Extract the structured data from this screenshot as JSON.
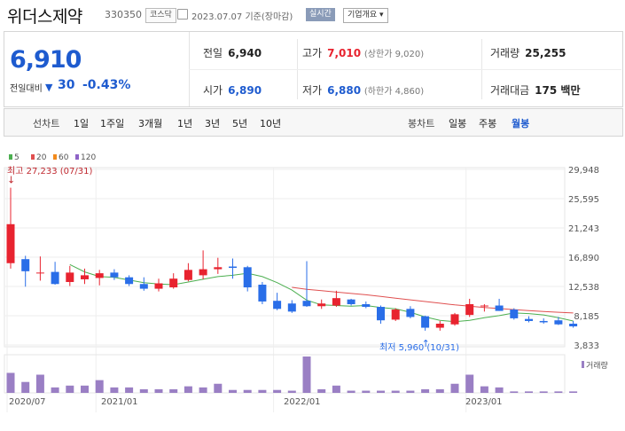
{
  "header": {
    "name": "위더스제약",
    "code": "330350",
    "market": "코스닥",
    "date": "2023.07.07",
    "basis": "기준(장마감)",
    "realtime": "실시간",
    "corp_overview": "기업개요 ▾"
  },
  "quote": {
    "price": "6,910",
    "change_label": "전일대비",
    "change_arrow": "▼",
    "change": "30",
    "change_pct": "-0.43%",
    "prev_close_label": "전일",
    "prev_close": "6,940",
    "high_label": "고가",
    "high": "7,010",
    "upper_limit": "(상한가 9,020)",
    "volume_label": "거래량",
    "volume": "25,255",
    "open_label": "시가",
    "open": "6,890",
    "low_label": "저가",
    "low": "6,880",
    "lower_limit": "(하한가 4,860)",
    "trade_value_label": "거래대금",
    "trade_value": "175 백만"
  },
  "toolbar": {
    "line_label": "선차트",
    "line_tabs": [
      "1일",
      "1주일",
      "3개월",
      "1년",
      "3년",
      "5년",
      "10년"
    ],
    "candle_label": "봉차트",
    "candle_tabs": [
      "일봉",
      "주봉",
      "월봉"
    ],
    "candle_selected": 2
  },
  "colors": {
    "up": "#e8232f",
    "down": "#2a6ee8",
    "ma5": "#4caf50",
    "ma20": "#e05050",
    "ma60": "#f28a1c",
    "ma120": "#8e63c7",
    "volume": "#9a7fc4",
    "accent": "#1e5bcf"
  },
  "chart_data": {
    "type": "candlestick",
    "legend": [
      "5",
      "20",
      "60",
      "120"
    ],
    "y_ticks": [
      "29,948",
      "25,595",
      "21,243",
      "16,890",
      "12,538",
      "8,185",
      "3,833"
    ],
    "ylim": [
      3833,
      29948
    ],
    "x_ticks": [
      "2020/07",
      "2021/01",
      "2022/01",
      "2023/01"
    ],
    "high_annotation": "최고 27,233 (07/31)",
    "low_annotation": "최저 5,960 (10/31)",
    "volume_label": "거래량",
    "candles": [
      {
        "o": 16000,
        "h": 27233,
        "l": 15200,
        "c": 21800
      },
      {
        "o": 16600,
        "h": 17100,
        "l": 12500,
        "c": 14800
      },
      {
        "o": 14600,
        "h": 17000,
        "l": 13400,
        "c": 14600
      },
      {
        "o": 14700,
        "h": 16200,
        "l": 12800,
        "c": 12900
      },
      {
        "o": 13200,
        "h": 15600,
        "l": 12600,
        "c": 14600
      },
      {
        "o": 13600,
        "h": 15200,
        "l": 12900,
        "c": 14200
      },
      {
        "o": 13800,
        "h": 15000,
        "l": 12700,
        "c": 14500
      },
      {
        "o": 14600,
        "h": 15100,
        "l": 13500,
        "c": 13900
      },
      {
        "o": 13900,
        "h": 14200,
        "l": 12600,
        "c": 12900
      },
      {
        "o": 12900,
        "h": 13900,
        "l": 11900,
        "c": 12200
      },
      {
        "o": 12200,
        "h": 13700,
        "l": 11800,
        "c": 13000
      },
      {
        "o": 12400,
        "h": 14500,
        "l": 12200,
        "c": 13700
      },
      {
        "o": 13500,
        "h": 16000,
        "l": 13300,
        "c": 15000
      },
      {
        "o": 14200,
        "h": 17900,
        "l": 13600,
        "c": 15100
      },
      {
        "o": 15100,
        "h": 16800,
        "l": 14400,
        "c": 15400
      },
      {
        "o": 15500,
        "h": 16700,
        "l": 13700,
        "c": 15300
      },
      {
        "o": 15400,
        "h": 15600,
        "l": 11800,
        "c": 12400
      },
      {
        "o": 12800,
        "h": 13200,
        "l": 9900,
        "c": 10300
      },
      {
        "o": 10400,
        "h": 11600,
        "l": 9000,
        "c": 9200
      },
      {
        "o": 10000,
        "h": 10500,
        "l": 8600,
        "c": 8800
      },
      {
        "o": 10400,
        "h": 16300,
        "l": 9500,
        "c": 9600
      },
      {
        "o": 9600,
        "h": 10600,
        "l": 9200,
        "c": 10000
      },
      {
        "o": 9700,
        "h": 11900,
        "l": 9500,
        "c": 10800
      },
      {
        "o": 10600,
        "h": 10700,
        "l": 9700,
        "c": 9900
      },
      {
        "o": 9900,
        "h": 10300,
        "l": 9300,
        "c": 9500
      },
      {
        "o": 9500,
        "h": 9700,
        "l": 7000,
        "c": 7500
      },
      {
        "o": 7600,
        "h": 9300,
        "l": 7400,
        "c": 9100
      },
      {
        "o": 9200,
        "h": 9600,
        "l": 7800,
        "c": 8000
      },
      {
        "o": 8100,
        "h": 8200,
        "l": 5960,
        "c": 6400
      },
      {
        "o": 6400,
        "h": 7400,
        "l": 5960,
        "c": 7000
      },
      {
        "o": 6900,
        "h": 8600,
        "l": 6700,
        "c": 8400
      },
      {
        "o": 8300,
        "h": 10700,
        "l": 8000,
        "c": 9900
      },
      {
        "o": 9600,
        "h": 9900,
        "l": 8800,
        "c": 9700
      },
      {
        "o": 9700,
        "h": 10700,
        "l": 8900,
        "c": 8900
      },
      {
        "o": 9100,
        "h": 9300,
        "l": 7600,
        "c": 7800
      },
      {
        "o": 7700,
        "h": 8100,
        "l": 7200,
        "c": 7400
      },
      {
        "o": 7400,
        "h": 7800,
        "l": 7000,
        "c": 7200
      },
      {
        "o": 7500,
        "h": 8000,
        "l": 6800,
        "c": 6900
      },
      {
        "o": 7000,
        "h": 7400,
        "l": 6400,
        "c": 6600
      }
    ],
    "ma5": [
      null,
      null,
      null,
      null,
      15800,
      14700,
      14000,
      13900,
      13500,
      13100,
      12900,
      12800,
      13200,
      13600,
      14000,
      14200,
      14500,
      14000,
      13100,
      12000,
      10500,
      9800,
      9700,
      9600,
      9700,
      9400,
      9200,
      8700,
      8000,
      7500,
      7300,
      7500,
      7900,
      8200,
      8600,
      8500,
      8300,
      7900,
      7400
    ],
    "ma20": [
      null,
      null,
      null,
      null,
      null,
      null,
      null,
      null,
      null,
      null,
      null,
      null,
      null,
      null,
      null,
      null,
      null,
      null,
      null,
      12400,
      12100,
      11900,
      11700,
      11500,
      11300,
      11050,
      10800,
      10550,
      10300,
      10050,
      9800,
      9600,
      9400,
      9250,
      9100,
      8950,
      8800,
      8700,
      8600
    ],
    "volume_rel": [
      0.55,
      0.3,
      0.5,
      0.15,
      0.2,
      0.2,
      0.35,
      0.15,
      0.15,
      0.1,
      0.1,
      0.1,
      0.18,
      0.15,
      0.25,
      0.08,
      0.08,
      0.08,
      0.08,
      0.06,
      1.0,
      0.1,
      0.2,
      0.06,
      0.06,
      0.06,
      0.06,
      0.06,
      0.1,
      0.1,
      0.25,
      0.5,
      0.18,
      0.15,
      0.04,
      0.04,
      0.04,
      0.04,
      0.04
    ]
  }
}
